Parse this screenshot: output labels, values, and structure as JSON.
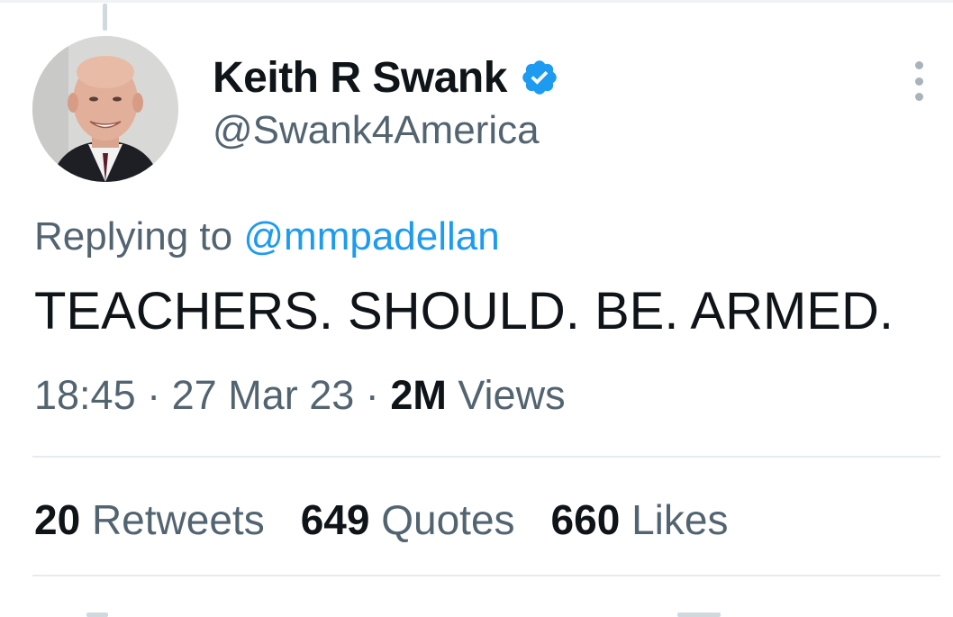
{
  "tweet": {
    "author": {
      "display_name": "Keith R Swank",
      "handle": "@Swank4America",
      "verified": true,
      "avatar_icon": "profile-photo"
    },
    "reply": {
      "prefix": "Replying to",
      "mention": "@mmpadellan"
    },
    "text": "TEACHERS. SHOULD. BE. ARMED.",
    "meta": {
      "time": "18:45",
      "separator": "·",
      "date": "27 Mar 23",
      "views_count": "2M",
      "views_label": "Views"
    },
    "stats": [
      {
        "count": "20",
        "label": "Retweets"
      },
      {
        "count": "649",
        "label": "Quotes"
      },
      {
        "count": "660",
        "label": "Likes"
      }
    ]
  },
  "colors": {
    "primary_text": "#0f1419",
    "secondary_text": "#536471",
    "accent": "#1d9bf0",
    "divider": "#e7ebed"
  },
  "icons": {
    "verified": "verified-badge-icon",
    "more": "more-options-icon"
  }
}
